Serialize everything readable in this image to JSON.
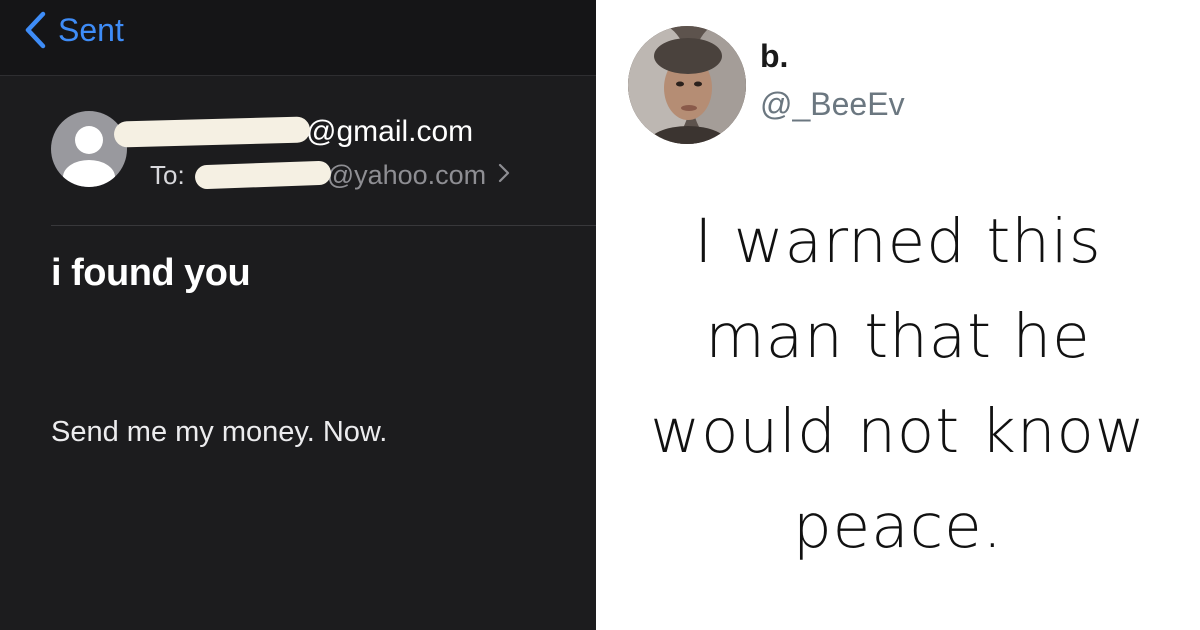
{
  "email": {
    "nav": {
      "back_label": "Sent"
    },
    "sender_domain": "@gmail.com",
    "to_label": "To:",
    "to_domain": "@yahoo.com",
    "subject": "i found you",
    "body": "Send me my money. Now."
  },
  "tweet": {
    "name": "b.",
    "handle": "@_BeeEv",
    "lines": [
      "I warned this",
      "man that he",
      "would not know",
      "peace."
    ]
  },
  "colors": {
    "accent_blue": "#3e8cf7",
    "mail_background": "#1c1c1e",
    "redaction": "#f5f0e3"
  },
  "icons": {
    "back": "chevron-left-icon",
    "contact": "person-icon",
    "disclosure": "chevron-right-icon"
  }
}
